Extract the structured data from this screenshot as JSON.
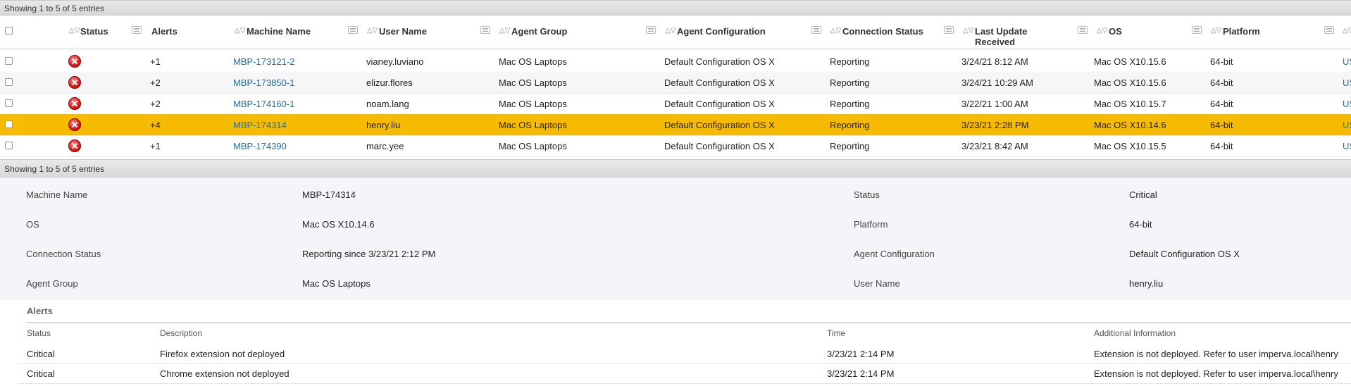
{
  "summary": {
    "top": "Showing 1 to 5 of 5 entries",
    "bottom": "Showing 1 to 5 of 5 entries"
  },
  "columns": {
    "status": "Status",
    "alerts": "Alerts",
    "machine": "Machine Name",
    "user": "User Name",
    "group": "Agent Group",
    "config": "Agent Configuration",
    "conn": "Connection Status",
    "update": "Last Update Received",
    "os": "OS",
    "platform": "Platform"
  },
  "rows": [
    {
      "alerts": "+1",
      "machine": "MBP-173121-2",
      "user": "vianey.luviano",
      "group": "Mac OS Laptops",
      "config": "Default Configuration OS X",
      "conn": "Reporting",
      "update": "3/24/21 8:12 AM",
      "os": "Mac OS X10.15.6",
      "platform": "64-bit",
      "extra": "US"
    },
    {
      "alerts": "+2",
      "machine": "MBP-173850-1",
      "user": "elizur.flores",
      "group": "Mac OS Laptops",
      "config": "Default Configuration OS X",
      "conn": "Reporting",
      "update": "3/24/21 10:29 AM",
      "os": "Mac OS X10.15.6",
      "platform": "64-bit",
      "extra": "US"
    },
    {
      "alerts": "+2",
      "machine": "MBP-174160-1",
      "user": "noam.lang",
      "group": "Mac OS Laptops",
      "config": "Default Configuration OS X",
      "conn": "Reporting",
      "update": "3/22/21 1:00 AM",
      "os": "Mac OS X10.15.7",
      "platform": "64-bit",
      "extra": "US"
    },
    {
      "alerts": "+4",
      "machine": "MBP-174314",
      "user": "henry.liu",
      "group": "Mac OS Laptops",
      "config": "Default Configuration OS X",
      "conn": "Reporting",
      "update": "3/23/21 2:28 PM",
      "os": "Mac OS X10.14.6",
      "platform": "64-bit",
      "extra": "US"
    },
    {
      "alerts": "+1",
      "machine": "MBP-174390",
      "user": "marc.yee",
      "group": "Mac OS Laptops",
      "config": "Default Configuration OS X",
      "conn": "Reporting",
      "update": "3/23/21 8:42 AM",
      "os": "Mac OS X10.15.5",
      "platform": "64-bit",
      "extra": "US"
    }
  ],
  "detail": {
    "machine_label": "Machine Name",
    "machine_value": "MBP-174314",
    "os_label": "OS",
    "os_value": "Mac OS X10.14.6",
    "conn_label": "Connection Status",
    "conn_value": "Reporting since 3/23/21 2:12 PM",
    "group_label": "Agent Group",
    "group_value": "Mac OS Laptops",
    "status_label": "Status",
    "status_value": "Critical",
    "platform_label": "Platform",
    "platform_value": "64-bit",
    "config_label": "Agent Configuration",
    "config_value": "Default Configuration OS X",
    "user_label": "User Name",
    "user_value": "henry.liu"
  },
  "alerts": {
    "title": "Alerts",
    "headers": {
      "status": "Status",
      "description": "Description",
      "time": "Time",
      "info": "Additional Information"
    },
    "rows": [
      {
        "status": "Critical",
        "description": "Firefox extension not deployed",
        "time": "3/23/21 2:14 PM",
        "info": "Extension is not deployed. Refer to user imperva.local\\henry"
      },
      {
        "status": "Critical",
        "description": "Chrome extension not deployed",
        "time": "3/23/21 2:14 PM",
        "info": "Extension is not deployed. Refer to user imperva.local\\henry"
      }
    ]
  },
  "colors": {
    "selected_row": "#f6bb00",
    "link": "#1d6fa5",
    "critical": "#d81b1b"
  }
}
